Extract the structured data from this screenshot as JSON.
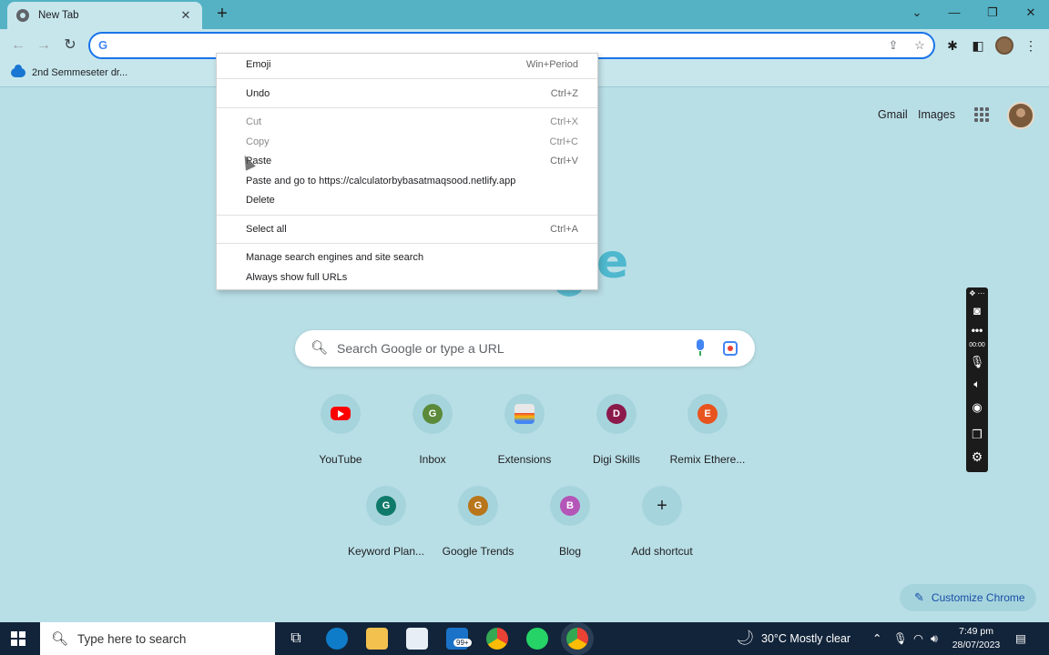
{
  "browser": {
    "tab_title": "New Tab",
    "tab_close": "✕",
    "new_tab": "+",
    "window_controls": {
      "dropdown": "⌄",
      "minimize": "—",
      "restore": "❐",
      "close": "✕"
    },
    "nav": {
      "back": "←",
      "forward": "→",
      "reload": "↻"
    },
    "omnibox": {
      "value": "",
      "g_logo": "G"
    },
    "bookmarks": [
      {
        "label": "2nd Semmeseter dr...",
        "icon": "onedrive-cloud-icon"
      }
    ]
  },
  "ntp": {
    "header_links": {
      "gmail": "Gmail",
      "images": "Images"
    },
    "search": {
      "placeholder": "Search Google or type a URL"
    },
    "shortcuts_row1": [
      {
        "label": "YouTube",
        "letter": "",
        "color": "#ff0000",
        "icon": "youtube-icon"
      },
      {
        "label": "Inbox",
        "letter": "G",
        "color": "#5b8a3a",
        "icon": "letter-avatar"
      },
      {
        "label": "Extensions",
        "letter": "",
        "color": "#e8e8e8",
        "icon": "extensions-icon"
      },
      {
        "label": "Digi Skills",
        "letter": "D",
        "color": "#8b1a4a",
        "icon": "letter-avatar"
      },
      {
        "label": "Remix Ethere...",
        "letter": "E",
        "color": "#e8541e",
        "icon": "letter-avatar"
      }
    ],
    "shortcuts_row2": [
      {
        "label": "Keyword Plan...",
        "letter": "G",
        "color": "#0f7a6a",
        "icon": "letter-avatar"
      },
      {
        "label": "Google Trends",
        "letter": "G",
        "color": "#b8751a",
        "icon": "letter-avatar"
      },
      {
        "label": "Blog",
        "letter": "B",
        "color": "#b455b8",
        "icon": "letter-avatar"
      },
      {
        "label": "Add shortcut",
        "letter": "+",
        "color": "transparent",
        "icon": "plus-icon"
      }
    ],
    "customize": "Customize Chrome"
  },
  "context_menu": {
    "items": [
      {
        "label": "Emoji",
        "shortcut": "Win+Period",
        "disabled": false
      },
      {
        "label": "Undo",
        "shortcut": "Ctrl+Z",
        "disabled": false
      },
      {
        "label": "Cut",
        "shortcut": "Ctrl+X",
        "disabled": true
      },
      {
        "label": "Copy",
        "shortcut": "Ctrl+C",
        "disabled": true
      },
      {
        "label": "Paste",
        "shortcut": "Ctrl+V",
        "disabled": false
      },
      {
        "label": "Paste and go to https://calculatorbybasatmaqsood.netlify.app",
        "shortcut": "",
        "disabled": false
      },
      {
        "label": "Delete",
        "shortcut": "",
        "disabled": false
      },
      {
        "label": "Select all",
        "shortcut": "Ctrl+A",
        "disabled": false
      },
      {
        "label": "Manage search engines and site search",
        "shortcut": "",
        "disabled": false
      },
      {
        "label": "Always show full URLs",
        "shortcut": "",
        "disabled": false
      }
    ]
  },
  "recorder": {
    "timer": "00:00"
  },
  "taskbar": {
    "search_placeholder": "Type here to search",
    "mail_badge": "99+",
    "weather": "30°C  Mostly clear",
    "time": "7:49 pm",
    "date": "28/07/2023"
  },
  "colors": {
    "accent": "#1a73e8",
    "page_bg": "#b9dfe6",
    "tabstrip": "#54b2c4",
    "taskbar": "#12243a"
  }
}
